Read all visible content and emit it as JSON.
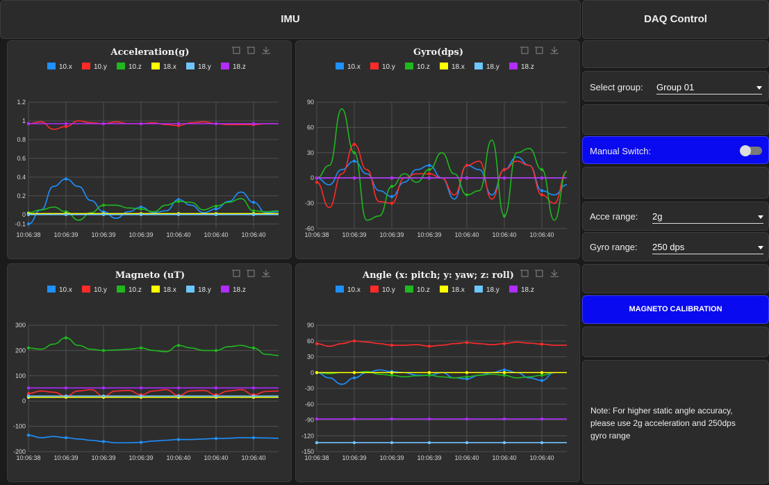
{
  "imu": {
    "title": "IMU"
  },
  "daq": {
    "title": "DAQ Control",
    "select_group_label": "Select group:",
    "select_group_value": "Group 01",
    "manual_switch_label": "Manual Switch:",
    "manual_switch_on": false,
    "acce_range_label": "Acce range:",
    "acce_range_value": "2g",
    "gyro_range_label": "Gyro range:",
    "gyro_range_value": "250 dps",
    "calibration_button": "MAGNETO CALIBRATION",
    "note_lines": [
      "Note: For higher static angle accuracy,",
      "please use 2g acceleration and 250dps",
      "gyro range"
    ]
  },
  "legend": [
    "10.x",
    "10.y",
    "10.z",
    "18.x",
    "18.y",
    "18.z"
  ],
  "colors": {
    "10.x": "#1e90ff",
    "10.y": "#ff2b2b",
    "10.z": "#1fb81f",
    "18.x": "#ffff00",
    "18.y": "#6ec6ff",
    "18.z": "#b02cff"
  },
  "x_ticks": [
    "10:06:38",
    "10:06:39",
    "10:06:39",
    "10:06:39",
    "10:06:40",
    "10:06:40",
    "10:06:40"
  ],
  "chart_data": [
    {
      "type": "line",
      "title": "Acceleration(g)",
      "ylim": [
        -0.15,
        1.2
      ],
      "yticks": [
        -0.1,
        0,
        0.2,
        0.4,
        0.6,
        0.8,
        1,
        1.2
      ],
      "yticklabels": [
        "-0.1",
        "0",
        "0.2",
        "0.4",
        "0.6",
        "0.8",
        "1",
        "1.2"
      ],
      "series": [
        {
          "name": "10.x",
          "values": [
            -0.1,
            0.05,
            0.3,
            0.38,
            0.3,
            0.15,
            0.03,
            -0.04,
            0.03,
            0.08,
            0.02,
            0.04,
            0.16,
            0.1,
            0.02,
            0.06,
            0.14,
            0.24,
            0.13,
            0.02,
            0.03
          ]
        },
        {
          "name": "10.y",
          "values": [
            0.97,
            0.99,
            0.91,
            0.94,
            1.0,
            0.98,
            0.97,
            0.99,
            0.97,
            0.97,
            0.98,
            0.96,
            0.95,
            0.98,
            0.99,
            0.97,
            0.96,
            0.96,
            0.96,
            0.97,
            0.97
          ]
        },
        {
          "name": "10.z",
          "values": [
            0.02,
            0.05,
            0.08,
            0.03,
            -0.06,
            0.02,
            0.1,
            0.1,
            0.07,
            0.06,
            0.03,
            0.1,
            0.14,
            0.13,
            0.05,
            0.09,
            0.13,
            0.17,
            0.04,
            0.03,
            0.04
          ]
        },
        {
          "name": "18.x",
          "values": [
            0.01,
            0.01,
            0.01,
            0.01,
            0.01,
            0.01,
            0.01,
            0.01,
            0.01,
            0.01,
            0.01,
            0.01,
            0.01,
            0.01,
            0.01,
            0.01,
            0.01,
            0.01,
            0.01,
            0.01,
            0.01
          ]
        },
        {
          "name": "18.y",
          "values": [
            0.0,
            0.0,
            0.0,
            0.0,
            0.0,
            0.0,
            0.0,
            0.0,
            0.0,
            0.0,
            0.0,
            0.0,
            0.0,
            0.0,
            0.0,
            0.0,
            0.0,
            0.0,
            0.0,
            0.0,
            0.0
          ]
        },
        {
          "name": "18.z",
          "values": [
            0.97,
            0.97,
            0.97,
            0.97,
            0.97,
            0.97,
            0.97,
            0.97,
            0.97,
            0.97,
            0.97,
            0.97,
            0.97,
            0.97,
            0.97,
            0.97,
            0.97,
            0.97,
            0.97,
            0.97,
            0.97
          ]
        }
      ]
    },
    {
      "type": "line",
      "title": "Gyro(dps)",
      "ylim": [
        -60,
        90
      ],
      "yticks": [
        -60,
        -30,
        0,
        30,
        60,
        90
      ],
      "yticklabels": [
        "-60",
        "-30",
        "0",
        "30",
        "60",
        "90"
      ],
      "series": [
        {
          "name": "10.x",
          "values": [
            0,
            -8,
            10,
            20,
            5,
            -15,
            -22,
            -5,
            10,
            15,
            0,
            -25,
            15,
            10,
            -20,
            10,
            25,
            15,
            -15,
            -20,
            -8
          ]
        },
        {
          "name": "10.y",
          "values": [
            -5,
            -35,
            5,
            40,
            10,
            -28,
            -30,
            0,
            5,
            5,
            0,
            -20,
            15,
            20,
            -25,
            10,
            20,
            15,
            -20,
            -30,
            8
          ]
        },
        {
          "name": "10.z",
          "values": [
            0,
            15,
            82,
            30,
            -50,
            -45,
            -10,
            5,
            -5,
            10,
            30,
            5,
            -20,
            -15,
            45,
            -45,
            30,
            35,
            10,
            -50,
            8
          ]
        },
        {
          "name": "18.x",
          "values": [
            0,
            0,
            0,
            0,
            0,
            0,
            0,
            0,
            0,
            0,
            0,
            0,
            0,
            0,
            0,
            0,
            0,
            0,
            0,
            0,
            0
          ]
        },
        {
          "name": "18.y",
          "values": [
            0,
            0,
            0,
            0,
            0,
            0,
            0,
            0,
            0,
            0,
            0,
            0,
            0,
            0,
            0,
            0,
            0,
            0,
            0,
            0,
            0
          ]
        },
        {
          "name": "18.z",
          "values": [
            0,
            0,
            0,
            0,
            0,
            0,
            0,
            0,
            0,
            0,
            0,
            0,
            0,
            0,
            0,
            0,
            0,
            0,
            0,
            0,
            0
          ]
        }
      ]
    },
    {
      "type": "line",
      "title": "Magneto (uT)",
      "ylim": [
        -200,
        300
      ],
      "yticks": [
        -200,
        -100,
        0,
        100,
        200,
        300
      ],
      "yticklabels": [
        "-200",
        "-100",
        "0",
        "100",
        "200",
        "300"
      ],
      "series": [
        {
          "name": "10.x",
          "values": [
            -135,
            -145,
            -140,
            -145,
            -150,
            -155,
            -160,
            -165,
            -165,
            -163,
            -158,
            -155,
            -152,
            -152,
            -150,
            -148,
            -147,
            -145,
            -145,
            -146,
            -147
          ]
        },
        {
          "name": "10.y",
          "values": [
            30,
            40,
            35,
            20,
            40,
            45,
            20,
            40,
            42,
            25,
            40,
            45,
            22,
            40,
            42,
            25,
            40,
            45,
            25,
            38,
            40
          ]
        },
        {
          "name": "10.z",
          "values": [
            210,
            205,
            225,
            250,
            220,
            205,
            200,
            202,
            205,
            210,
            200,
            195,
            220,
            210,
            200,
            200,
            215,
            220,
            210,
            185,
            180
          ]
        },
        {
          "name": "18.x",
          "values": [
            15,
            15,
            15,
            15,
            15,
            15,
            15,
            15,
            15,
            15,
            15,
            15,
            15,
            15,
            15,
            15,
            15,
            15,
            15,
            15,
            15
          ]
        },
        {
          "name": "18.y",
          "values": [
            20,
            20,
            20,
            20,
            20,
            20,
            20,
            20,
            20,
            20,
            20,
            20,
            20,
            20,
            20,
            20,
            20,
            20,
            20,
            20,
            20
          ]
        },
        {
          "name": "18.z",
          "values": [
            52,
            52,
            52,
            52,
            52,
            52,
            52,
            52,
            52,
            52,
            52,
            52,
            52,
            52,
            52,
            52,
            52,
            52,
            52,
            52,
            52
          ]
        }
      ]
    },
    {
      "type": "line",
      "title": "Angle (x: pitch; y: yaw; z: roll)",
      "ylim": [
        -150,
        90
      ],
      "yticks": [
        -150,
        -120,
        -90,
        -60,
        -30,
        0,
        30,
        60,
        90
      ],
      "yticklabels": [
        "-150",
        "-120",
        "-90",
        "-60",
        "-30",
        "0",
        "30",
        "60",
        "90"
      ],
      "series": [
        {
          "name": "10.x",
          "values": [
            0,
            -10,
            -22,
            -10,
            0,
            5,
            2,
            0,
            -5,
            -5,
            0,
            -10,
            -12,
            -5,
            0,
            5,
            0,
            -10,
            -15,
            0,
            0
          ]
        },
        {
          "name": "10.y",
          "values": [
            55,
            50,
            55,
            60,
            58,
            55,
            52,
            52,
            53,
            50,
            52,
            55,
            57,
            55,
            53,
            55,
            58,
            56,
            54,
            52,
            52
          ]
        },
        {
          "name": "10.z",
          "values": [
            0,
            -2,
            0,
            0,
            2,
            -3,
            -5,
            -8,
            -6,
            -5,
            -8,
            -10,
            -8,
            -5,
            -3,
            -5,
            -10,
            -8,
            -5,
            0,
            0
          ]
        },
        {
          "name": "18.x",
          "values": [
            0,
            0,
            0,
            0,
            0,
            0,
            0,
            0,
            0,
            0,
            0,
            0,
            0,
            0,
            0,
            0,
            0,
            0,
            0,
            0,
            0
          ]
        },
        {
          "name": "18.y",
          "values": [
            -133,
            -133,
            -133,
            -133,
            -133,
            -133,
            -133,
            -133,
            -133,
            -133,
            -133,
            -133,
            -133,
            -133,
            -133,
            -133,
            -133,
            -133,
            -133,
            -133,
            -133
          ]
        },
        {
          "name": "18.z",
          "values": [
            -88,
            -88,
            -88,
            -88,
            -88,
            -88,
            -88,
            -88,
            -88,
            -88,
            -88,
            -88,
            -88,
            -88,
            -88,
            -88,
            -88,
            -88,
            -88,
            -88,
            -88
          ]
        }
      ]
    }
  ]
}
